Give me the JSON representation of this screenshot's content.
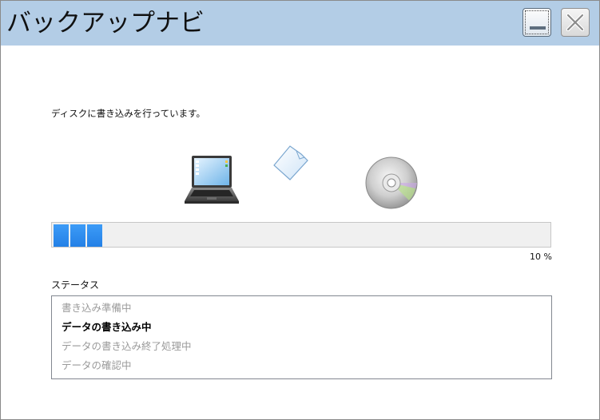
{
  "window": {
    "title": "バックアップナビ"
  },
  "titlebar_buttons": {
    "minimize": "minimize-icon",
    "close": "close-icon"
  },
  "main": {
    "message": "ディスクに書き込みを行っています。",
    "illustrations": [
      "laptop-icon",
      "document-icon",
      "disc-icon"
    ],
    "progress": {
      "percent": 10,
      "label": "10 %",
      "color": "#2f8ff0"
    },
    "status": {
      "label": "ステータス",
      "items": [
        {
          "text": "書き込み準備中",
          "state": "inactive"
        },
        {
          "text": "データの書き込み中",
          "state": "active"
        },
        {
          "text": "データの書き込み終了処理中",
          "state": "inactive"
        },
        {
          "text": "データの確認中",
          "state": "inactive"
        }
      ]
    }
  },
  "colors": {
    "titlebar": "#b3cde6",
    "progress_fill": "#2f8ff0",
    "progress_track": "#f0f0f0"
  }
}
